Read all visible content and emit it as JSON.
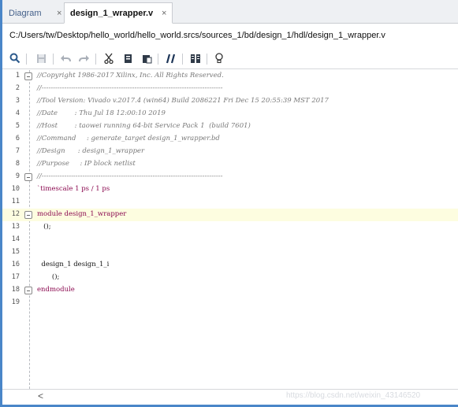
{
  "tabs": [
    {
      "label": "Diagram",
      "close": "×"
    },
    {
      "label": "design_1_wrapper.v",
      "close": "×"
    }
  ],
  "path": "C:/Users/tw/Desktop/hello_world/hello_world.srcs/sources_1/bd/design_1/hdl/design_1_wrapper.v",
  "toolbar_icons": [
    "search-icon",
    "save-icon",
    "undo-icon",
    "redo-icon",
    "cut-icon",
    "copy-icon",
    "paste-icon",
    "comment-icon",
    "columns-icon",
    "lightbulb-icon"
  ],
  "lines": [
    {
      "n": "1",
      "text": "//Copyright 1986-2017 Xilinx, Inc. All Rights Reserved."
    },
    {
      "n": "2",
      "text": "//--------------------------------------------------------------------------------"
    },
    {
      "n": "3",
      "text": "//Tool Version: Vivado v.2017.4 (win64) Build 2086221 Fri Dec 15 20:55:39 MST 2017"
    },
    {
      "n": "4",
      "text": "//Date        : Thu Jul 18 12:00:10 2019"
    },
    {
      "n": "5",
      "text": "//Host        : taowei running 64-bit Service Pack 1  (build 7601)"
    },
    {
      "n": "6",
      "text": "//Command     : generate_target design_1_wrapper.bd"
    },
    {
      "n": "7",
      "text": "//Design      : design_1_wrapper"
    },
    {
      "n": "8",
      "text": "//Purpose     : IP block netlist"
    },
    {
      "n": "9",
      "text": "//--------------------------------------------------------------------------------"
    },
    {
      "n": "10",
      "text": "`timescale 1 ps / 1 ps"
    },
    {
      "n": "11",
      "text": ""
    },
    {
      "n": "12",
      "text": "module design_1_wrapper"
    },
    {
      "n": "13",
      "text": "   ();"
    },
    {
      "n": "14",
      "text": ""
    },
    {
      "n": "15",
      "text": ""
    },
    {
      "n": "16",
      "text": "  design_1 design_1_i"
    },
    {
      "n": "17",
      "text": "       ();"
    },
    {
      "n": "18",
      "text": "endmodule"
    },
    {
      "n": "19",
      "text": ""
    }
  ],
  "scroll_left": "<",
  "watermark": "https://blog.csdn.net/weixin_43146520"
}
